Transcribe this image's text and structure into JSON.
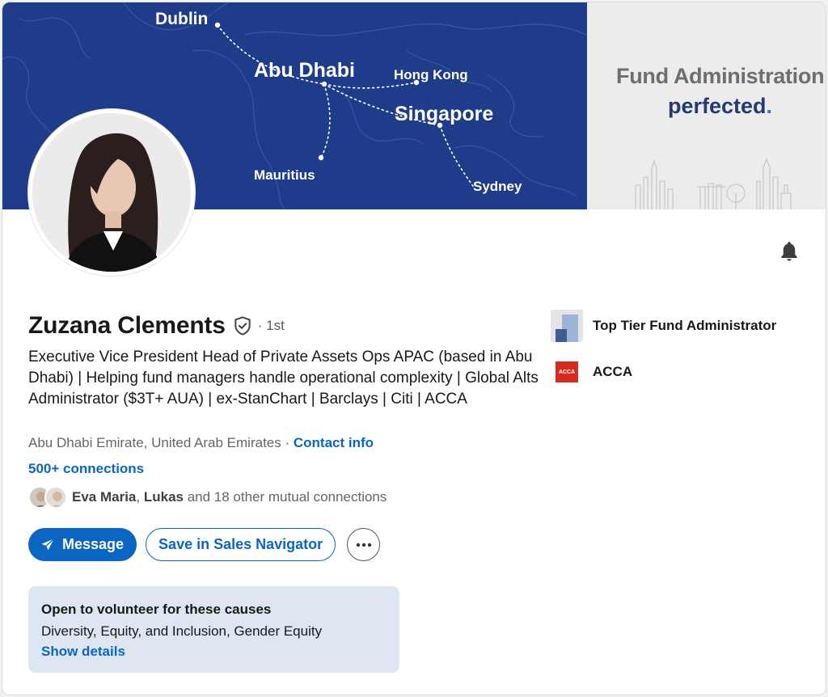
{
  "banner": {
    "cities": {
      "dublin": "Dublin",
      "abu_dhabi": "Abu Dhabi",
      "hong_kong": "Hong Kong",
      "singapore": "Singapore",
      "mauritius": "Mauritius",
      "sydney": "Sydney"
    },
    "tagline_line1": "Fund Administration",
    "tagline_line2": "perfected",
    "tagline_dot": ".",
    "map_color": "#1f3c8a"
  },
  "profile": {
    "name": "Zuzana Clements",
    "degree": "· 1st",
    "headline": "Executive Vice President Head of Private Assets Ops APAC (based in Abu Dhabi) | Helping fund managers handle operational complexity | Global Alts Administrator ($3T+ AUA) | ex-StanChart | Barclays | Citi | ACCA",
    "location": "Abu Dhabi Emirate, United Arab Emirates",
    "contact_separator": " · ",
    "contact_link": "Contact info",
    "connections": "500+ connections",
    "mutual": {
      "name1": "Eva Maria",
      "separator": ", ",
      "name2": "Lukas",
      "rest": " and 18 other mutual connections"
    }
  },
  "actions": {
    "message": "Message",
    "save": "Save in Sales Navigator",
    "more_icon": "ellipsis-icon"
  },
  "volunteer": {
    "title": "Open to volunteer for these causes",
    "causes": "Diversity, Equity, and Inclusion, Gender Equity",
    "link": "Show details"
  },
  "organizations": [
    {
      "name": "Top Tier Fund Administrator",
      "logo": "top-tier-logo"
    },
    {
      "name": "ACCA",
      "logo": "acca-logo",
      "logo_text": "ACCA"
    }
  ],
  "colors": {
    "accent": "#0a66c2",
    "volunteer_bg": "#dde6f1",
    "acca_red": "#d42b1e"
  }
}
